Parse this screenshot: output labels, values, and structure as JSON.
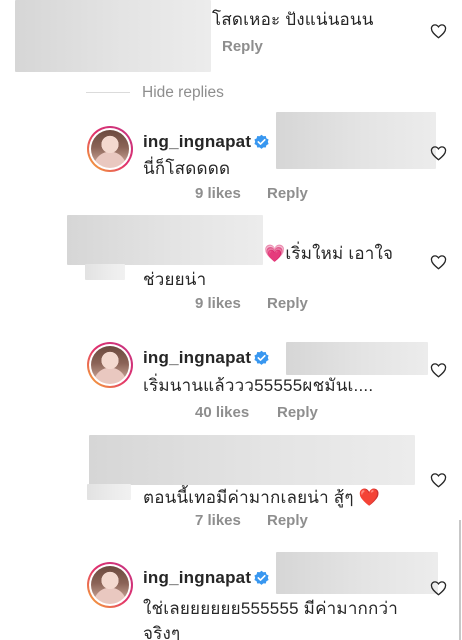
{
  "comments": [
    {
      "text_lines": [
        "โสดเหอะ ปังแน่นอนน"
      ],
      "reply_label": "Reply"
    }
  ],
  "hide_replies_label": "Hide replies",
  "replies": [
    {
      "username": "ing_ingnapat",
      "text_lines": [
        "นี่ก็โสดดดด"
      ],
      "likes": "9 likes",
      "reply_label": "Reply"
    },
    {
      "text_lines": [
        "💗เริ่มใหม่ เอาใจ",
        "ช่วยยน่า"
      ],
      "likes": "9 likes",
      "reply_label": "Reply"
    },
    {
      "username": "ing_ingnapat",
      "text_lines": [
        "เริ่มนานแล้ววว55555ผชมันเ...."
      ],
      "likes": "40 likes",
      "reply_label": "Reply"
    },
    {
      "text_lines": [
        "ตอนนี้เทอมีค่ามากเลยน่า  สู้ๆ ❤️"
      ],
      "likes": "7 likes",
      "reply_label": "Reply"
    },
    {
      "username": "ing_ingnapat",
      "text_lines": [
        "ใช่เลยยยยยย555555 มีค่ามากกว่า",
        "จริงๆ"
      ]
    }
  ],
  "icons": {
    "like": "heart-outline-icon",
    "verified": "verified-badge-icon"
  },
  "colors": {
    "text": "#262626",
    "muted": "#8e8e8e",
    "verified": "#3897f0",
    "heart_emoji": "#e0245e"
  }
}
